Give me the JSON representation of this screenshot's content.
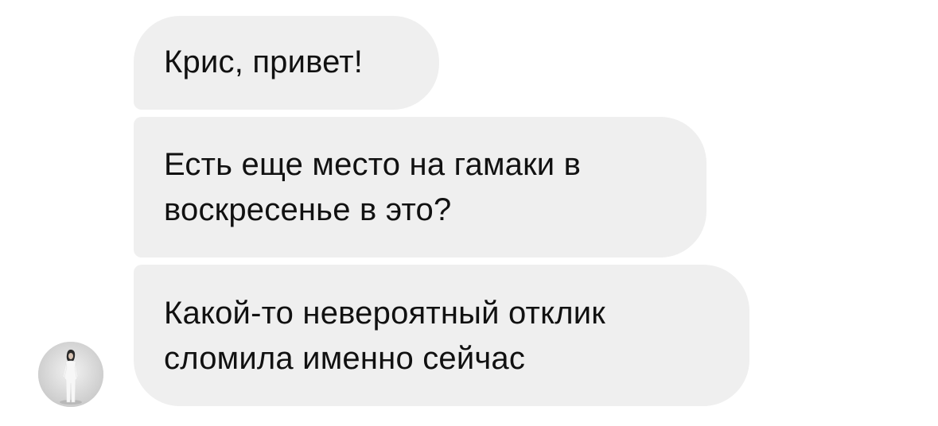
{
  "messages": [
    {
      "lines": [
        "Крис, привет!"
      ]
    },
    {
      "lines": [
        "Есть еще место на гамаки в",
        "воскресенье в это?"
      ]
    },
    {
      "lines": [
        "Какой-то невероятный отклик",
        "сломила именно сейчас"
      ]
    }
  ],
  "colors": {
    "bubble_background": "#efefef",
    "text": "#111111",
    "page_background": "#ffffff"
  },
  "avatar": {
    "icon": "person-photo-icon"
  }
}
